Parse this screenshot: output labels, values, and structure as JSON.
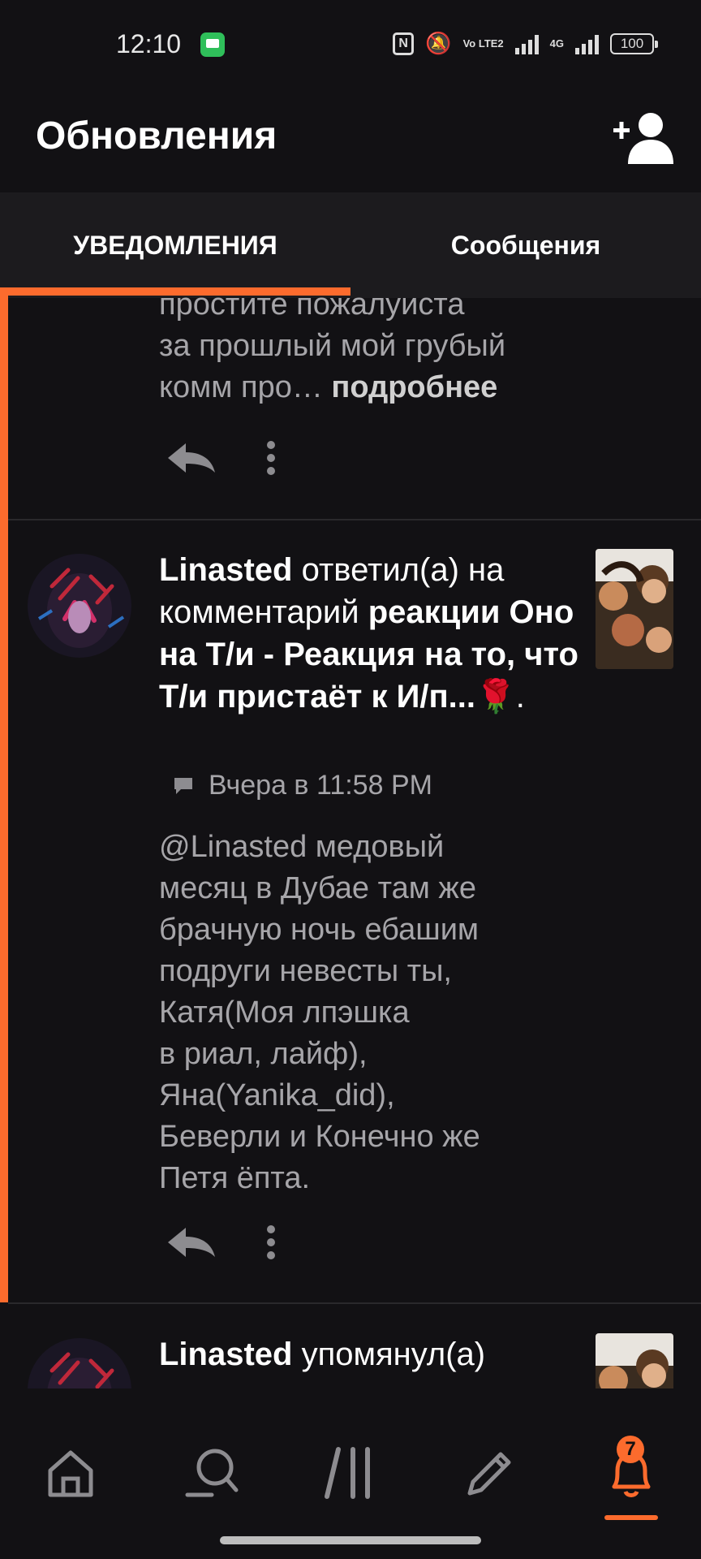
{
  "status_bar": {
    "time": "12:10",
    "network": "4G",
    "volte": "Vo LTE2",
    "battery": "100"
  },
  "header": {
    "title": "Обновления"
  },
  "tabs": [
    {
      "label": "УВЕДОМЛЕНИЯ"
    },
    {
      "label": "Сообщения"
    }
  ],
  "feed": {
    "items": [
      {
        "text_lines": [
          "простите пожалуиста",
          "за прошлый мой грубый",
          "комм про…"
        ],
        "more": "подробнее"
      },
      {
        "user": "Linasted",
        "action": "ответил(а) на комментарий",
        "story": "реакции Оно на Т/и - Реакция на то, что Т/и пристаёт к И/п...🌹",
        "period": ".",
        "time": "Вчера в 11:58 PM",
        "comment_lines": [
          "@Linasted медовый",
          "месяц в Дубае там же",
          "брачную ночь ебашим",
          "подруги невесты ты,",
          "Катя(Моя лпэшка",
          "в риал, лайф),",
          "Яна(Yanika_did),",
          "Беверли и Конечно же",
          "Петя ёпта."
        ]
      },
      {
        "user": "Linasted",
        "action": "упомянул(а)"
      }
    ]
  },
  "bottom_nav": {
    "badge_count": "7"
  },
  "colors": {
    "accent": "#fc6b2d",
    "background": "#121114",
    "tab_bg": "#1c1b1e"
  }
}
